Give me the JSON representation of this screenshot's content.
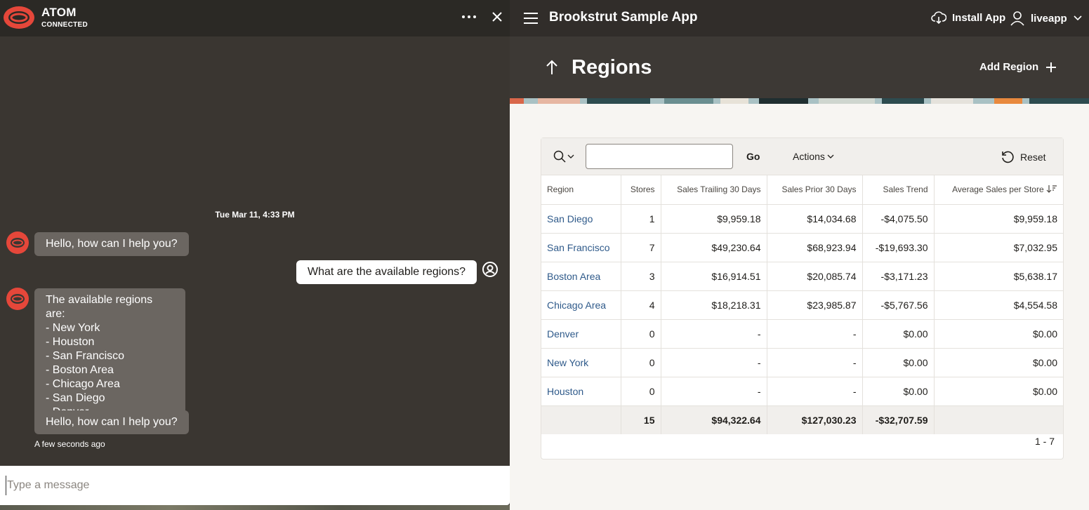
{
  "chat": {
    "title": "ATOM",
    "status": "CONNECTED",
    "timestamp": "Tue Mar 11, 4:33 PM",
    "messages": [
      {
        "from": "bot",
        "text": "Hello, how can I help you?"
      },
      {
        "from": "user",
        "text": "What are the available regions?"
      },
      {
        "from": "bot",
        "lines": [
          "The available regions are:",
          "- New York",
          "- Houston",
          "- San Francisco",
          "- Boston Area",
          "- Chicago Area",
          "- San Diego",
          "- Denver"
        ]
      },
      {
        "from": "bot",
        "text": "Hello, how can I help you?"
      }
    ],
    "last_seen": "A few seconds ago",
    "composer_placeholder": "Type a message",
    "colors": {
      "header": "#2b2925",
      "background": "#3a3631",
      "bot_bubble": "#6b6661",
      "logo": "#e5473a"
    }
  },
  "app": {
    "title": "Brookstrut Sample App",
    "install_label": "Install App",
    "user_label": "liveapp",
    "page_title": "Regions",
    "add_label": "Add Region",
    "toolbar": {
      "go_label": "Go",
      "actions_label": "Actions",
      "reset_label": "Reset",
      "search_value": ""
    },
    "columns": [
      "Region",
      "Stores",
      "Sales Trailing 30 Days",
      "Sales Prior 30 Days",
      "Sales Trend",
      "Average Sales per Store"
    ],
    "sort_icon": "sort-descending-icon",
    "rows": [
      [
        "San Diego",
        "1",
        "$9,959.18",
        "$14,034.68",
        "-$4,075.50",
        "$9,959.18"
      ],
      [
        "San Francisco",
        "7",
        "$49,230.64",
        "$68,923.94",
        "-$19,693.30",
        "$7,032.95"
      ],
      [
        "Boston Area",
        "3",
        "$16,914.51",
        "$20,085.74",
        "-$3,171.23",
        "$5,638.17"
      ],
      [
        "Chicago Area",
        "4",
        "$18,218.31",
        "$23,985.87",
        "-$5,767.56",
        "$4,554.58"
      ],
      [
        "Denver",
        "0",
        "-",
        "-",
        "$0.00",
        "$0.00"
      ],
      [
        "New York",
        "0",
        "-",
        "-",
        "$0.00",
        "$0.00"
      ],
      [
        "Houston",
        "0",
        "-",
        "-",
        "$0.00",
        "$0.00"
      ]
    ],
    "totals": [
      "",
      "15",
      "$94,322.64",
      "$127,030.23",
      "-$32,707.59",
      ""
    ],
    "pagination": "1 - 7",
    "colors": {
      "topbar": "#312d2a",
      "link": "#2f5a8a",
      "hero": "#3d3935"
    }
  }
}
